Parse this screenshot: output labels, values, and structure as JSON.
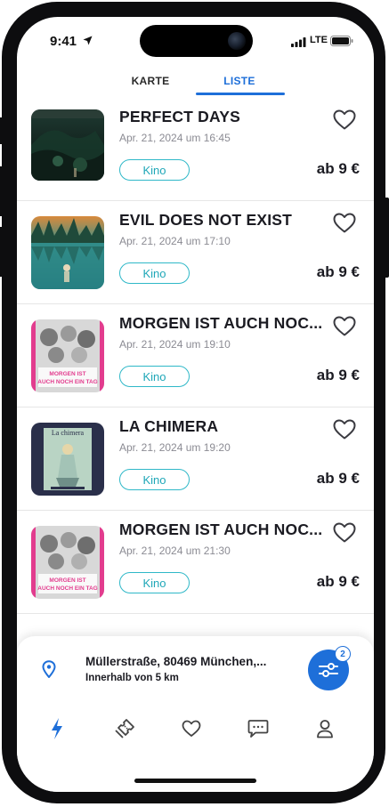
{
  "status_bar": {
    "time": "9:41",
    "network": "LTE"
  },
  "tabs": [
    {
      "label": "KARTE",
      "active": false
    },
    {
      "label": "LISTE",
      "active": true
    }
  ],
  "accent_color": "#1e6fd9",
  "badge_color": "#2fb8c8",
  "events": [
    {
      "title": "PERFECT DAYS",
      "datetime": "Apr. 21, 2024 um 16:45",
      "category": "Kino",
      "price": "ab 9 €",
      "poster_icon": "perfect-days-poster"
    },
    {
      "title": "EVIL DOES NOT EXIST",
      "datetime": "Apr. 21, 2024 um 17:10",
      "category": "Kino",
      "price": "ab 9 €",
      "poster_icon": "evil-does-not-exist-poster"
    },
    {
      "title": "MORGEN IST AUCH NOC...",
      "datetime": "Apr. 21, 2024 um 19:10",
      "category": "Kino",
      "price": "ab 9 €",
      "poster_icon": "morgen-ist-auch-noch-ein-tag-poster",
      "poster_text": "MORGEN IST AUCH NOCH EIN TAG"
    },
    {
      "title": "LA CHIMERA",
      "datetime": "Apr. 21, 2024 um 19:20",
      "category": "Kino",
      "price": "ab 9 €",
      "poster_icon": "la-chimera-poster",
      "poster_text": "La chimera"
    },
    {
      "title": "MORGEN IST AUCH NOC...",
      "datetime": "Apr. 21, 2024 um 21:30",
      "category": "Kino",
      "price": "ab 9 €",
      "poster_icon": "morgen-ist-auch-noch-ein-tag-poster",
      "poster_text": "MORGEN IST AUCH NOCH EIN TAG"
    }
  ],
  "location": {
    "address": "Müllerstraße, 80469 München,...",
    "radius": "Innerhalb von 5 km"
  },
  "filter": {
    "count": "2"
  },
  "bottom_nav": [
    {
      "icon": "lightning-icon",
      "active": true
    },
    {
      "icon": "ticket-icon",
      "active": false
    },
    {
      "icon": "heart-icon",
      "active": false
    },
    {
      "icon": "chat-icon",
      "active": false
    },
    {
      "icon": "profile-icon",
      "active": false
    }
  ]
}
